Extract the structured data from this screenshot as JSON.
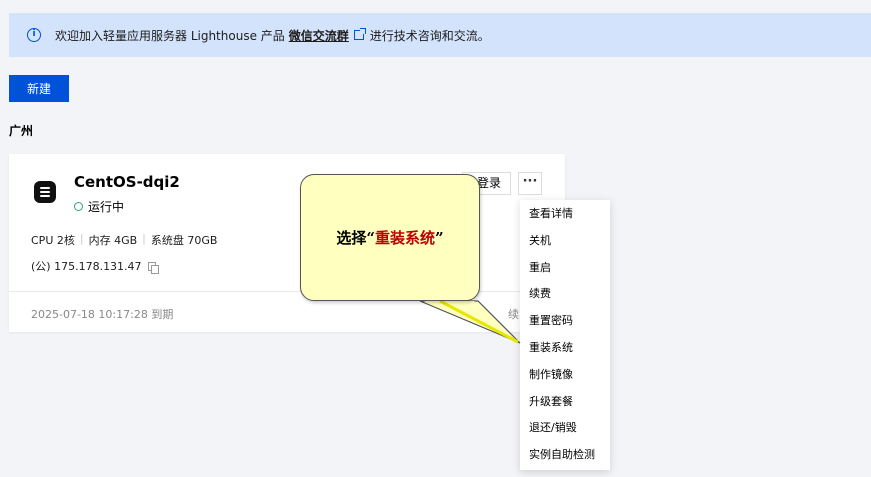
{
  "notice": {
    "text_before": "欢迎加入轻量应用服务器 Lighthouse 产品",
    "link": "微信交流群",
    "text_after": "进行技术咨询和交流。"
  },
  "toolbar": {
    "new_label": "新建"
  },
  "region": "广州",
  "instance": {
    "name": "CentOS-dqi2",
    "status": "运行中",
    "cpu": "CPU 2核",
    "memory": "内存 4GB",
    "disk": "系统盘 70GB",
    "ip": "(公) 175.178.131.47",
    "expire": "2025-07-18 10:17:28 到期",
    "renew_partial": "续",
    "login_partial": "登录",
    "more_label": "···"
  },
  "menu": {
    "items": [
      "查看详情",
      "关机",
      "重启",
      "续费",
      "重置密码",
      "重装系统",
      "制作镜像",
      "升级套餐",
      "退还/销毁",
      "实例自助检测"
    ]
  },
  "callout": {
    "prefix": "选择“",
    "highlight": "重装系统",
    "suffix": "”"
  },
  "colors": {
    "primary": "#0052d9",
    "notice_bg": "#d4e3fc",
    "status_green": "#2ba471",
    "callout_bg": "#ffffc0",
    "callout_highlight": "#c00000"
  }
}
